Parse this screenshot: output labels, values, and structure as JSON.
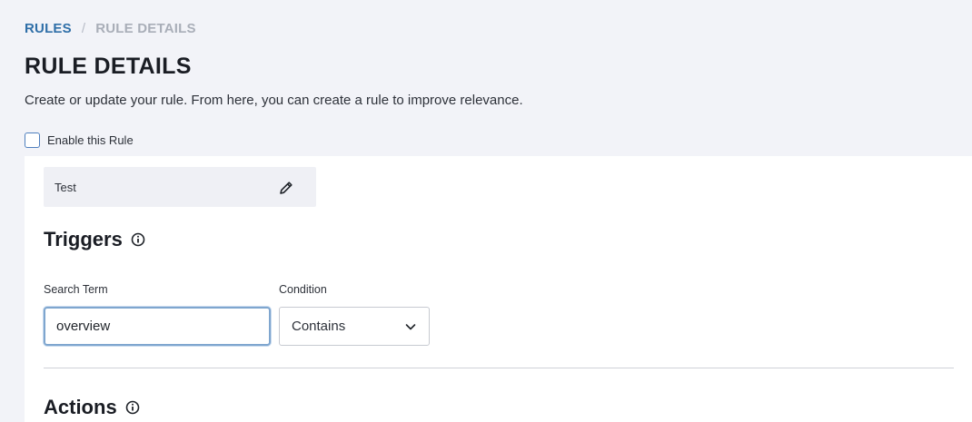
{
  "breadcrumb": {
    "root": "RULES",
    "separator": "/",
    "current": "RULE DETAILS"
  },
  "page": {
    "title": "RULE DETAILS",
    "description": "Create or update your rule. From here, you can create a rule to improve relevance."
  },
  "enable_rule": {
    "label": "Enable this Rule",
    "checked": false
  },
  "rule_name": {
    "value": "Test",
    "edit_icon": "pencil-icon"
  },
  "triggers": {
    "title": "Triggers",
    "info_icon": "info-icon",
    "search_term": {
      "label": "Search Term",
      "value": "overview"
    },
    "condition": {
      "label": "Condition",
      "value": "Contains",
      "icon": "chevron-down-icon"
    }
  },
  "actions": {
    "title": "Actions",
    "info_icon": "info-icon"
  },
  "colors": {
    "background": "#f2f3f8",
    "panel": "#ffffff",
    "breadcrumb_link": "#2f6fa8",
    "input_focus_border": "#7fa6cf"
  }
}
